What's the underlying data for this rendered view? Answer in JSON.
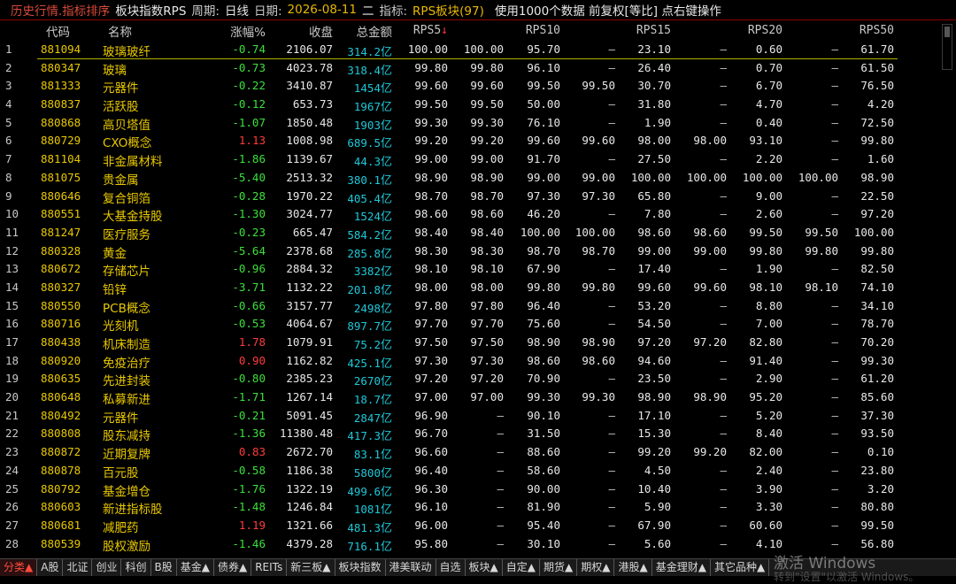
{
  "title": {
    "app": "历史行情.指标排序",
    "name": "板块指数RPS",
    "period_label": "周期:",
    "period_value": "日线",
    "date_label": "日期:",
    "date_value": "2026-08-11",
    "weekday": "二",
    "indicator_label": "指标:",
    "indicator_value": "RPS板块(97)",
    "note": "使用1000个数据 前复权[等比] 点右键操作"
  },
  "columns": {
    "code": "代码",
    "name": "名称",
    "change": "涨幅%",
    "close": "收盘",
    "amount": "总金额",
    "rps5": "RPS5",
    "rps5_sort": "↓",
    "rps10": "RPS10",
    "rps15": "RPS15",
    "rps20": "RPS20",
    "rps50": "RPS50"
  },
  "rows": [
    {
      "i": "1",
      "code": "881094",
      "name": "玻璃玻纤",
      "chg": "-0.74",
      "close": "2106.07",
      "amt": "314.2",
      "v": [
        "100.00",
        "100.00",
        "95.70",
        "—",
        "23.10",
        "—",
        "0.60",
        "—",
        "61.70"
      ]
    },
    {
      "i": "2",
      "code": "880347",
      "name": "玻璃",
      "chg": "-0.73",
      "close": "4023.78",
      "amt": "318.4",
      "v": [
        "99.80",
        "99.80",
        "96.10",
        "—",
        "26.40",
        "—",
        "0.70",
        "—",
        "61.50"
      ]
    },
    {
      "i": "3",
      "code": "881333",
      "name": "元器件",
      "chg": "-0.22",
      "close": "3410.87",
      "amt": "1454",
      "v": [
        "99.60",
        "99.60",
        "99.50",
        "99.50",
        "30.70",
        "—",
        "6.70",
        "—",
        "76.50"
      ]
    },
    {
      "i": "4",
      "code": "880837",
      "name": "活跃股",
      "chg": "-0.12",
      "close": "653.73",
      "amt": "1967",
      "v": [
        "99.50",
        "99.50",
        "50.00",
        "—",
        "31.80",
        "—",
        "4.70",
        "—",
        "4.20"
      ]
    },
    {
      "i": "5",
      "code": "880868",
      "name": "高贝塔值",
      "chg": "-1.07",
      "close": "1850.48",
      "amt": "1903",
      "v": [
        "99.30",
        "99.30",
        "76.10",
        "—",
        "1.90",
        "—",
        "0.40",
        "—",
        "72.50"
      ]
    },
    {
      "i": "6",
      "code": "880729",
      "name": "CXO概念",
      "chg": "1.13",
      "close": "1008.98",
      "amt": "689.5",
      "v": [
        "99.20",
        "99.20",
        "99.60",
        "99.60",
        "98.00",
        "98.00",
        "93.10",
        "—",
        "99.80"
      ]
    },
    {
      "i": "7",
      "code": "881104",
      "name": "非金属材料",
      "chg": "-1.86",
      "close": "1139.67",
      "amt": "44.3",
      "v": [
        "99.00",
        "99.00",
        "91.70",
        "—",
        "27.50",
        "—",
        "2.20",
        "—",
        "1.60"
      ]
    },
    {
      "i": "8",
      "code": "881075",
      "name": "贵金属",
      "chg": "-5.40",
      "close": "2513.32",
      "amt": "380.1",
      "v": [
        "98.90",
        "98.90",
        "99.00",
        "99.00",
        "100.00",
        "100.00",
        "100.00",
        "100.00",
        "98.90"
      ]
    },
    {
      "i": "9",
      "code": "880646",
      "name": "复合铜箔",
      "chg": "-0.28",
      "close": "1970.22",
      "amt": "405.4",
      "v": [
        "98.70",
        "98.70",
        "97.30",
        "97.30",
        "65.80",
        "—",
        "9.00",
        "—",
        "22.50"
      ]
    },
    {
      "i": "10",
      "code": "880551",
      "name": "大基金持股",
      "chg": "-1.30",
      "close": "3024.77",
      "amt": "1524",
      "v": [
        "98.60",
        "98.60",
        "46.20",
        "—",
        "7.80",
        "—",
        "2.60",
        "—",
        "97.20"
      ]
    },
    {
      "i": "11",
      "code": "881247",
      "name": "医疗服务",
      "chg": "-0.23",
      "close": "665.47",
      "amt": "584.2",
      "v": [
        "98.40",
        "98.40",
        "100.00",
        "100.00",
        "98.60",
        "98.60",
        "99.50",
        "99.50",
        "100.00"
      ]
    },
    {
      "i": "12",
      "code": "880328",
      "name": "黄金",
      "chg": "-5.64",
      "close": "2378.68",
      "amt": "285.8",
      "v": [
        "98.30",
        "98.30",
        "98.70",
        "98.70",
        "99.00",
        "99.00",
        "99.80",
        "99.80",
        "99.80"
      ]
    },
    {
      "i": "13",
      "code": "880672",
      "name": "存储芯片",
      "chg": "-0.96",
      "close": "2884.32",
      "amt": "3382",
      "v": [
        "98.10",
        "98.10",
        "67.90",
        "—",
        "17.40",
        "—",
        "1.90",
        "—",
        "82.50"
      ]
    },
    {
      "i": "14",
      "code": "880327",
      "name": "铅锌",
      "chg": "-3.71",
      "close": "1132.22",
      "amt": "201.8",
      "v": [
        "98.00",
        "98.00",
        "99.80",
        "99.80",
        "99.60",
        "99.60",
        "98.10",
        "98.10",
        "74.10"
      ]
    },
    {
      "i": "15",
      "code": "880550",
      "name": "PCB概念",
      "chg": "-0.66",
      "close": "3157.77",
      "amt": "2498",
      "v": [
        "97.80",
        "97.80",
        "96.40",
        "—",
        "53.20",
        "—",
        "8.80",
        "—",
        "34.10"
      ]
    },
    {
      "i": "16",
      "code": "880716",
      "name": "光刻机",
      "chg": "-0.53",
      "close": "4064.67",
      "amt": "897.7",
      "v": [
        "97.70",
        "97.70",
        "75.60",
        "—",
        "54.50",
        "—",
        "7.00",
        "—",
        "78.70"
      ]
    },
    {
      "i": "17",
      "code": "880438",
      "name": "机床制造",
      "chg": "1.78",
      "close": "1079.91",
      "amt": "75.2",
      "v": [
        "97.50",
        "97.50",
        "98.90",
        "98.90",
        "97.20",
        "97.20",
        "82.80",
        "—",
        "70.20"
      ]
    },
    {
      "i": "18",
      "code": "880920",
      "name": "免疫治疗",
      "chg": "0.90",
      "close": "1162.82",
      "amt": "425.1",
      "v": [
        "97.30",
        "97.30",
        "98.60",
        "98.60",
        "94.60",
        "—",
        "91.40",
        "—",
        "99.30"
      ]
    },
    {
      "i": "19",
      "code": "880635",
      "name": "先进封装",
      "chg": "-0.80",
      "close": "2385.23",
      "amt": "2670",
      "v": [
        "97.20",
        "97.20",
        "70.90",
        "—",
        "23.50",
        "—",
        "2.90",
        "—",
        "61.20"
      ]
    },
    {
      "i": "20",
      "code": "880648",
      "name": "私募新进",
      "chg": "-1.71",
      "close": "1267.14",
      "amt": "18.7",
      "v": [
        "97.00",
        "97.00",
        "99.30",
        "99.30",
        "98.90",
        "98.90",
        "95.20",
        "—",
        "85.60"
      ]
    },
    {
      "i": "21",
      "code": "880492",
      "name": "元器件",
      "chg": "-0.21",
      "close": "5091.45",
      "amt": "2847",
      "v": [
        "96.90",
        "—",
        "90.10",
        "—",
        "17.10",
        "—",
        "5.20",
        "—",
        "37.30"
      ]
    },
    {
      "i": "22",
      "code": "880808",
      "name": "股东减持",
      "chg": "-1.36",
      "close": "11380.48",
      "amt": "417.3",
      "v": [
        "96.70",
        "—",
        "31.50",
        "—",
        "15.30",
        "—",
        "8.40",
        "—",
        "93.50"
      ]
    },
    {
      "i": "23",
      "code": "880872",
      "name": "近期复牌",
      "chg": "0.83",
      "close": "2672.70",
      "amt": "83.1",
      "v": [
        "96.60",
        "—",
        "88.60",
        "—",
        "99.20",
        "99.20",
        "82.00",
        "—",
        "0.10"
      ]
    },
    {
      "i": "24",
      "code": "880878",
      "name": "百元股",
      "chg": "-0.58",
      "close": "1186.38",
      "amt": "5800",
      "v": [
        "96.40",
        "—",
        "58.60",
        "—",
        "4.50",
        "—",
        "2.40",
        "—",
        "23.80"
      ]
    },
    {
      "i": "25",
      "code": "880792",
      "name": "基金增仓",
      "chg": "-1.76",
      "close": "1322.19",
      "amt": "499.6",
      "v": [
        "96.30",
        "—",
        "90.00",
        "—",
        "10.40",
        "—",
        "3.90",
        "—",
        "3.20"
      ]
    },
    {
      "i": "26",
      "code": "880603",
      "name": "新进指标股",
      "chg": "-1.48",
      "close": "1246.84",
      "amt": "1081",
      "v": [
        "96.10",
        "—",
        "81.90",
        "—",
        "5.90",
        "—",
        "3.30",
        "—",
        "80.80"
      ]
    },
    {
      "i": "27",
      "code": "880681",
      "name": "减肥药",
      "chg": "1.19",
      "close": "1321.66",
      "amt": "481.3",
      "v": [
        "96.00",
        "—",
        "95.40",
        "—",
        "67.90",
        "—",
        "60.60",
        "—",
        "99.50"
      ]
    },
    {
      "i": "28",
      "code": "880539",
      "name": "股权激励",
      "chg": "-1.46",
      "close": "4379.28",
      "amt": "716.1",
      "v": [
        "95.80",
        "—",
        "30.10",
        "—",
        "5.60",
        "—",
        "4.10",
        "—",
        "56.80"
      ]
    }
  ],
  "amount_unit": "亿",
  "tabs": [
    "分类▲",
    "A股",
    "北证",
    "创业",
    "科创",
    "B股",
    "基金▲",
    "债券▲",
    "REITs",
    "新三板▲",
    "板块指数",
    "港美联动",
    "自选",
    "板块▲",
    "自定▲",
    "期货▲",
    "期权▲",
    "港股▲",
    "基金理财▲",
    "其它品种▲"
  ],
  "watermark": "激活 Windows",
  "watermark_sub": "转到\"设置\"以激活 Windows。",
  "colors": {
    "up": "#ff3b3b",
    "down": "#3ce03c",
    "code": "#e8c800",
    "amount": "#1ec8d8",
    "title_bar_border": "#8c0000"
  }
}
